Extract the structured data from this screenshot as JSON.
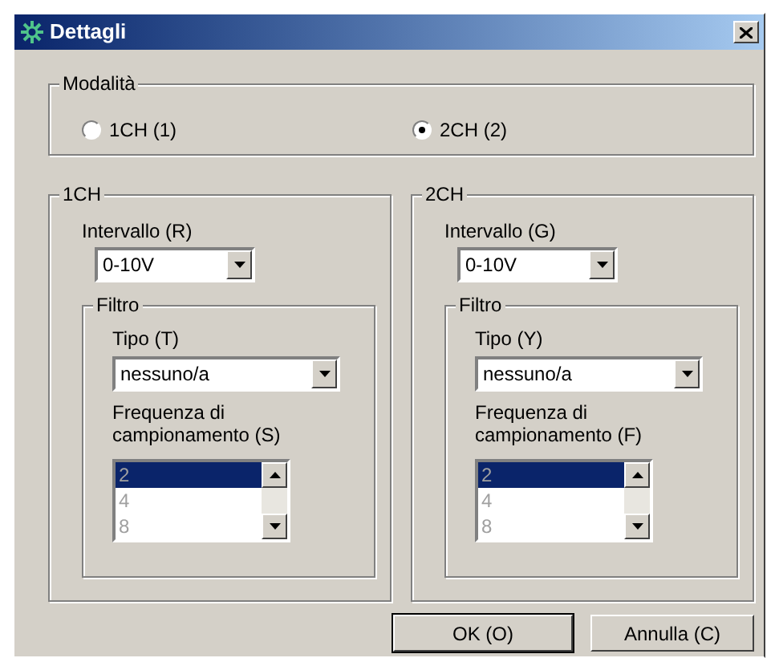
{
  "window": {
    "title": "Dettagli"
  },
  "mode": {
    "label": "Modalità",
    "options": [
      {
        "label": "1CH (1)",
        "selected": false
      },
      {
        "label": "2CH (2)",
        "selected": true
      }
    ]
  },
  "channels": [
    {
      "title": "1CH",
      "range_label": "Intervallo (R)",
      "range_value": "0-10V",
      "filter": {
        "title": "Filtro",
        "type_label": "Tipo (T)",
        "type_value": "nessuno/a",
        "rate_label": "Frequenza di campionamento (S)",
        "rate_disabled": true,
        "rates": [
          {
            "label": "2",
            "selected": true
          },
          {
            "label": "4",
            "selected": false
          },
          {
            "label": "8",
            "selected": false
          }
        ]
      }
    },
    {
      "title": "2CH",
      "range_label": "Intervallo (G)",
      "range_value": "0-10V",
      "filter": {
        "title": "Filtro",
        "type_label": "Tipo (Y)",
        "type_value": "nessuno/a",
        "rate_label": "Frequenza di campionamento (F)",
        "rate_disabled": true,
        "rates": [
          {
            "label": "2",
            "selected": true
          },
          {
            "label": "4",
            "selected": false
          },
          {
            "label": "8",
            "selected": false
          }
        ]
      }
    }
  ],
  "buttons": [
    {
      "label": "OK (O)",
      "default": true
    },
    {
      "label": "Annulla (C)",
      "default": false
    }
  ]
}
